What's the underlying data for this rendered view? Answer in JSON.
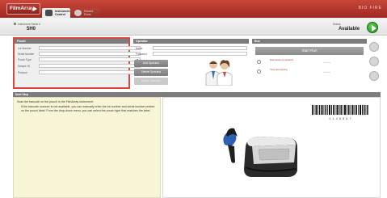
{
  "app": {
    "logo": "FilmArray"
  },
  "tabs": [
    {
      "label": "Instrument Control"
    },
    {
      "label": "Recent Runs"
    }
  ],
  "brand": "BIO FIRE",
  "instrument": {
    "serial_label": "Instrument Serial #",
    "serial_value": "5H0",
    "status_label": "Status",
    "status_value": "Available"
  },
  "pouch": {
    "title": "Pouch",
    "fields": [
      {
        "label": "Lot Number",
        "value": ""
      },
      {
        "label": "Serial Number",
        "value": ""
      },
      {
        "label": "Pouch Type",
        "value": ""
      },
      {
        "label": "Sample ID",
        "value": ""
      },
      {
        "label": "Protocol",
        "value": ""
      }
    ]
  },
  "operator": {
    "title": "Operator",
    "name_label": "Name",
    "password_label": "Password",
    "buttons": [
      "Add Operator",
      "Delete Operator",
      "Modify Operator"
    ]
  },
  "run": {
    "title": "Run",
    "start_label": "Start Run",
    "rows": [
      {
        "label": "Estimated Completion",
        "value": "--:--:--"
      },
      {
        "label": "Time Remaining",
        "value": "--:--:--"
      }
    ]
  },
  "next_step": {
    "title": "Next Step",
    "paragraphs": [
      "Scan the barcode on the pouch in the FilmArray instrument.",
      "If the barcode scanner is not available, you can manually enter the lot number and serial number printed on the pouch label. From the drop-down menu, you can select the pouch type that matches the label."
    ],
    "barcode_text": "1 1 4 8 6 8 7"
  },
  "colors": {
    "accent": "#c0392b",
    "status_go": "#2a9d2a",
    "instruction_bg": "#f8f4d6"
  },
  "icons": [
    "play-icon",
    "instrument-icon",
    "runs-icon",
    "go-arrow-icon",
    "operator-avatars",
    "settings-icon",
    "help-icon",
    "log-icon"
  ]
}
